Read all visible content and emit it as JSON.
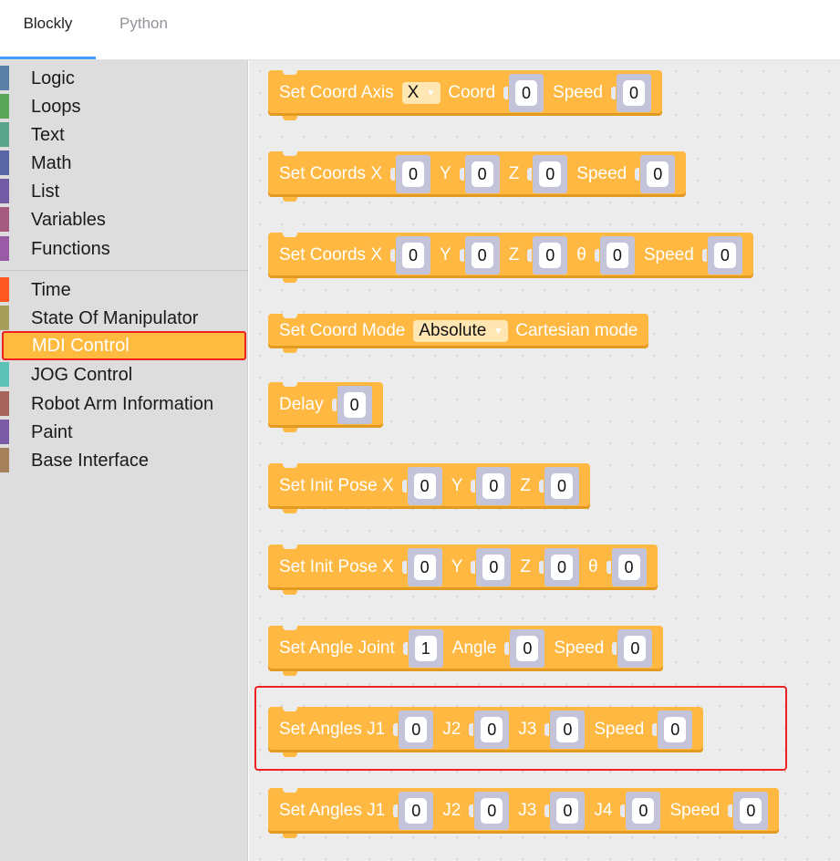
{
  "tabs": [
    {
      "label": "Blockly",
      "active": true
    },
    {
      "label": "Python",
      "active": false
    }
  ],
  "toolbox": {
    "categories": [
      {
        "label": "Logic",
        "color": "#5b80a5"
      },
      {
        "label": "Loops",
        "color": "#5ba55b"
      },
      {
        "label": "Text",
        "color": "#5ba58c"
      },
      {
        "label": "Math",
        "color": "#5b67a5"
      },
      {
        "label": "List",
        "color": "#745ba5"
      },
      {
        "label": "Variables",
        "color": "#a55b80"
      },
      {
        "label": "Functions",
        "color": "#995ba5"
      },
      {
        "label": "Time",
        "color": "#ff5722"
      },
      {
        "label": "State Of Manipulator",
        "color": "#a59f5b"
      },
      {
        "label": "MDI Control",
        "color": "#ffbb40"
      },
      {
        "label": "JOG Control",
        "color": "#5bc0b5"
      },
      {
        "label": "Robot Arm Information",
        "color": "#a5655b"
      },
      {
        "label": "Paint",
        "color": "#7b5ba5"
      },
      {
        "label": "Base Interface",
        "color": "#a5805b"
      }
    ],
    "selected": "MDI Control"
  },
  "blocks": [
    {
      "parts": [
        [
          "t",
          "Set Coord Axis"
        ],
        [
          "d",
          "X"
        ],
        [
          "t",
          "Coord"
        ],
        [
          "n",
          "0"
        ],
        [
          "t",
          "Speed"
        ],
        [
          "n",
          "0"
        ]
      ]
    },
    {
      "parts": [
        [
          "t",
          "Set Coords X"
        ],
        [
          "n",
          "0"
        ],
        [
          "t",
          "Y"
        ],
        [
          "n",
          "0"
        ],
        [
          "t",
          "Z"
        ],
        [
          "n",
          "0"
        ],
        [
          "t",
          "Speed"
        ],
        [
          "n",
          "0"
        ]
      ]
    },
    {
      "parts": [
        [
          "t",
          "Set Coords X"
        ],
        [
          "n",
          "0"
        ],
        [
          "t",
          "Y"
        ],
        [
          "n",
          "0"
        ],
        [
          "t",
          "Z"
        ],
        [
          "n",
          "0"
        ],
        [
          "t",
          "θ"
        ],
        [
          "n",
          "0"
        ],
        [
          "t",
          "Speed"
        ],
        [
          "n",
          "0"
        ]
      ]
    },
    {
      "parts": [
        [
          "t",
          "Set Coord Mode"
        ],
        [
          "d",
          "Absolute"
        ],
        [
          "t",
          "Cartesian mode"
        ]
      ]
    },
    {
      "parts": [
        [
          "t",
          "Delay"
        ],
        [
          "n",
          "0"
        ]
      ]
    },
    {
      "parts": [
        [
          "t",
          "Set Init Pose X"
        ],
        [
          "n",
          "0"
        ],
        [
          "t",
          "Y"
        ],
        [
          "n",
          "0"
        ],
        [
          "t",
          "Z"
        ],
        [
          "n",
          "0"
        ]
      ]
    },
    {
      "parts": [
        [
          "t",
          "Set Init Pose X"
        ],
        [
          "n",
          "0"
        ],
        [
          "t",
          "Y"
        ],
        [
          "n",
          "0"
        ],
        [
          "t",
          "Z"
        ],
        [
          "n",
          "0"
        ],
        [
          "t",
          "θ"
        ],
        [
          "n",
          "0"
        ]
      ]
    },
    {
      "parts": [
        [
          "t",
          "Set Angle Joint"
        ],
        [
          "n",
          "1"
        ],
        [
          "t",
          "Angle"
        ],
        [
          "n",
          "0"
        ],
        [
          "t",
          "Speed"
        ],
        [
          "n",
          "0"
        ]
      ]
    },
    {
      "parts": [
        [
          "t",
          "Set Angles J1"
        ],
        [
          "n",
          "0"
        ],
        [
          "t",
          "J2"
        ],
        [
          "n",
          "0"
        ],
        [
          "t",
          "J3"
        ],
        [
          "n",
          "0"
        ],
        [
          "t",
          "Speed"
        ],
        [
          "n",
          "0"
        ]
      ]
    },
    {
      "parts": [
        [
          "t",
          "Set Angles J1"
        ],
        [
          "n",
          "0"
        ],
        [
          "t",
          "J2"
        ],
        [
          "n",
          "0"
        ],
        [
          "t",
          "J3"
        ],
        [
          "n",
          "0"
        ],
        [
          "t",
          "J4"
        ],
        [
          "n",
          "0"
        ],
        [
          "t",
          "Speed"
        ],
        [
          "n",
          "0"
        ]
      ]
    }
  ]
}
